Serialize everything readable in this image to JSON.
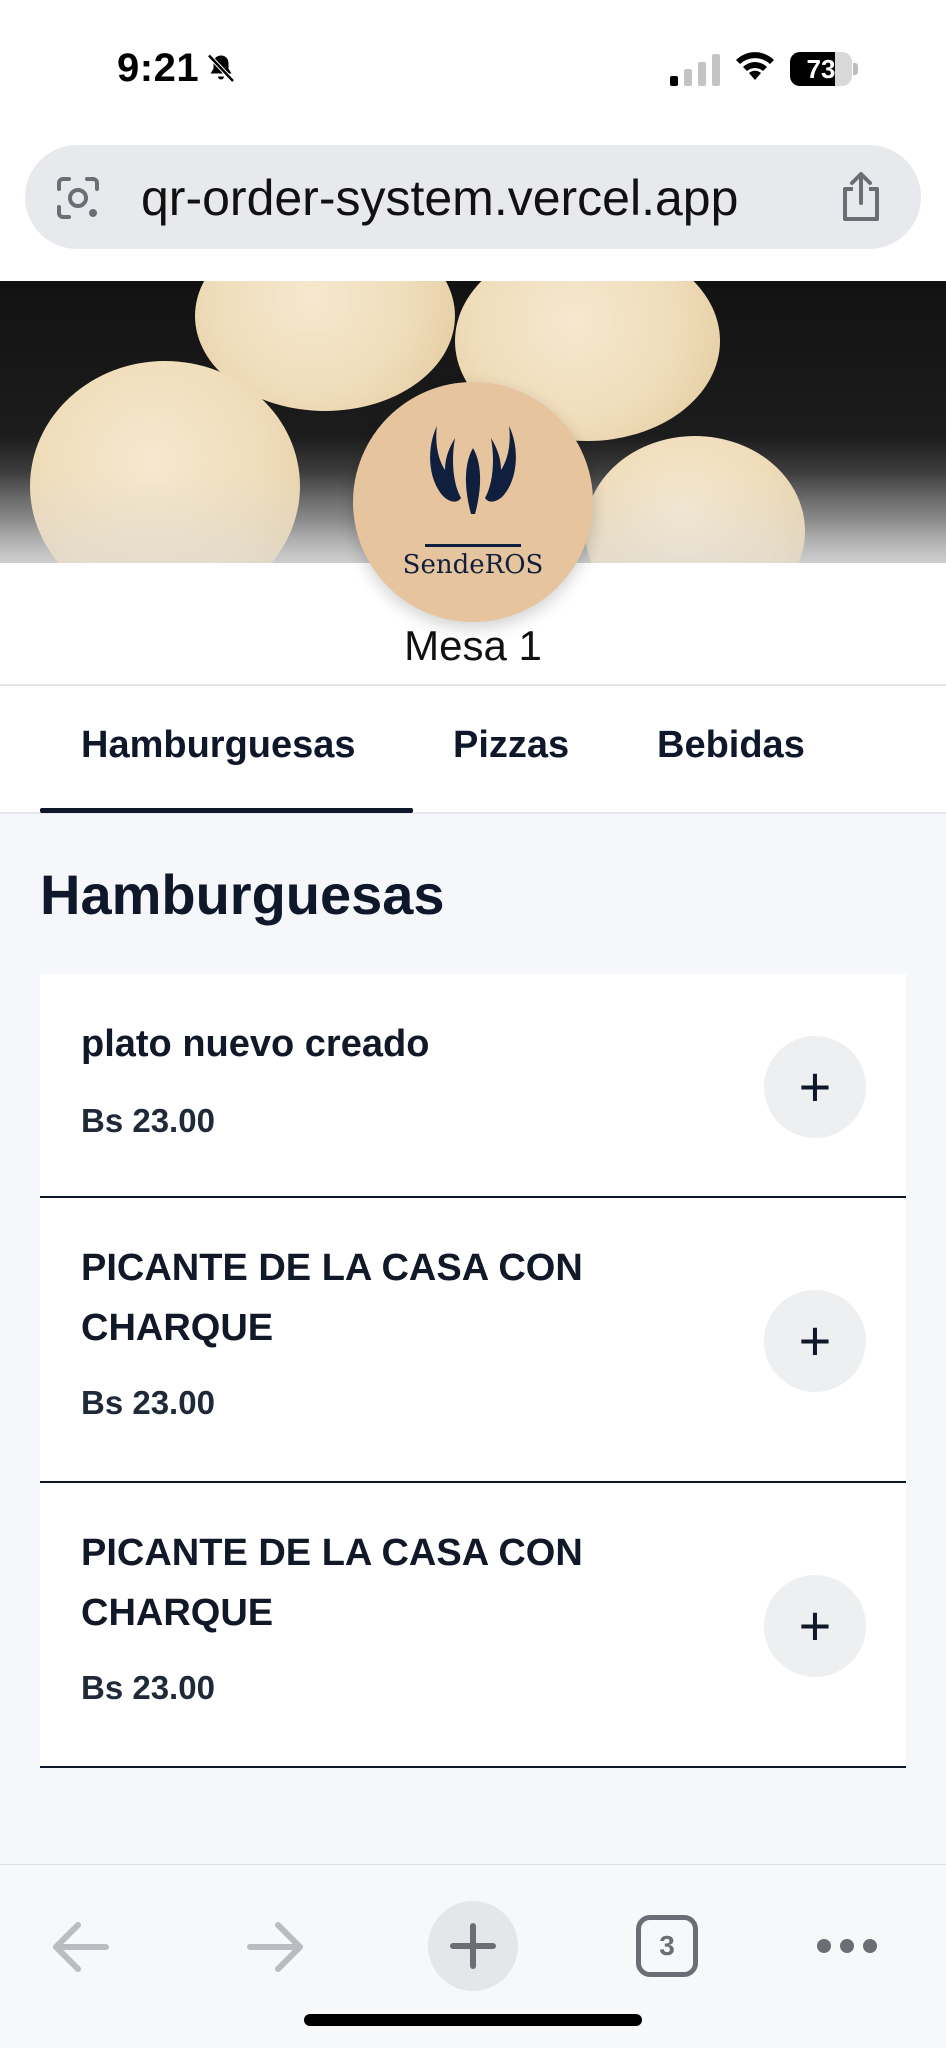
{
  "status_bar": {
    "time": "9:21",
    "battery": "73",
    "battery_level": 0.73,
    "icons": [
      "bell-slash-icon",
      "cellular-signal-icon",
      "wifi-icon",
      "battery-icon"
    ]
  },
  "browser": {
    "url": "qr-order-system.vercel.app",
    "icons": [
      "lens-icon",
      "share-icon"
    ],
    "toolbar": {
      "icons": [
        "back-arrow-icon",
        "forward-arrow-icon",
        "new-tab-plus-icon",
        "tabs-icon",
        "more-icon"
      ],
      "tab_count": "3"
    }
  },
  "restaurant": {
    "logo_text": "SendeROS",
    "table_label": "Mesa 1"
  },
  "tabs": [
    {
      "label": "Hamburguesas",
      "active": true
    },
    {
      "label": "Pizzas",
      "active": false
    },
    {
      "label": "Bebidas",
      "active": false
    }
  ],
  "section": {
    "title": "Hamburguesas",
    "items": [
      {
        "name": "plato nuevo creado",
        "price": "Bs 23.00",
        "add_label": "+"
      },
      {
        "name": "PICANTE DE LA CASA CON CHARQUE",
        "price": "Bs 23.00",
        "add_label": "+"
      },
      {
        "name": "PICANTE DE LA CASA CON CHARQUE",
        "price": "Bs 23.00",
        "add_label": "+"
      }
    ]
  },
  "colors": {
    "primary_text": "#0f172a",
    "logo_background": "#e6c49e",
    "logo_ink": "#0f1f3d",
    "page_background": "#f5f7fa"
  }
}
